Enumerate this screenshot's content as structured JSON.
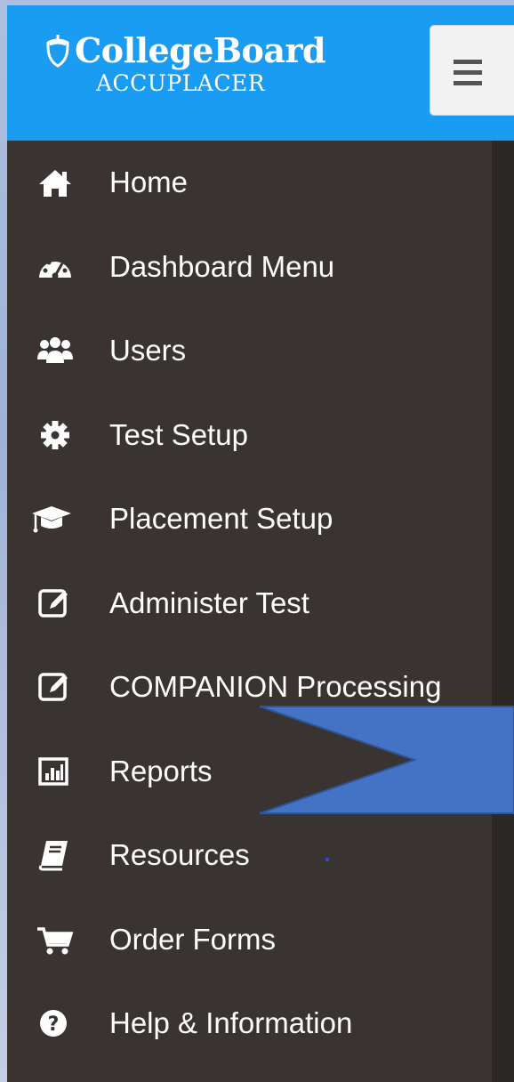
{
  "header": {
    "brand_name": "CollegeBoard",
    "brand_sub": "ACCUPLACER",
    "brand_color": "#1a9cf2",
    "menu_button_icon": "hamburger-icon"
  },
  "sidebar": {
    "background": "#393431",
    "items": [
      {
        "label": "Home",
        "icon": "home-icon"
      },
      {
        "label": "Dashboard Menu",
        "icon": "dashboard-icon"
      },
      {
        "label": "Users",
        "icon": "users-icon"
      },
      {
        "label": "Test Setup",
        "icon": "gear-icon"
      },
      {
        "label": "Placement Setup",
        "icon": "graduation-cap-icon"
      },
      {
        "label": "Administer Test",
        "icon": "edit-icon"
      },
      {
        "label": "COMPANION Processing",
        "icon": "edit-icon"
      },
      {
        "label": "Reports",
        "icon": "bar-chart-icon"
      },
      {
        "label": "Resources",
        "icon": "book-icon"
      },
      {
        "label": "Order Forms",
        "icon": "cart-icon"
      },
      {
        "label": "Help & Information",
        "icon": "question-circle-icon"
      }
    ]
  },
  "annotation": {
    "arrow_color": "#4472c4",
    "points_to": "Reports"
  }
}
